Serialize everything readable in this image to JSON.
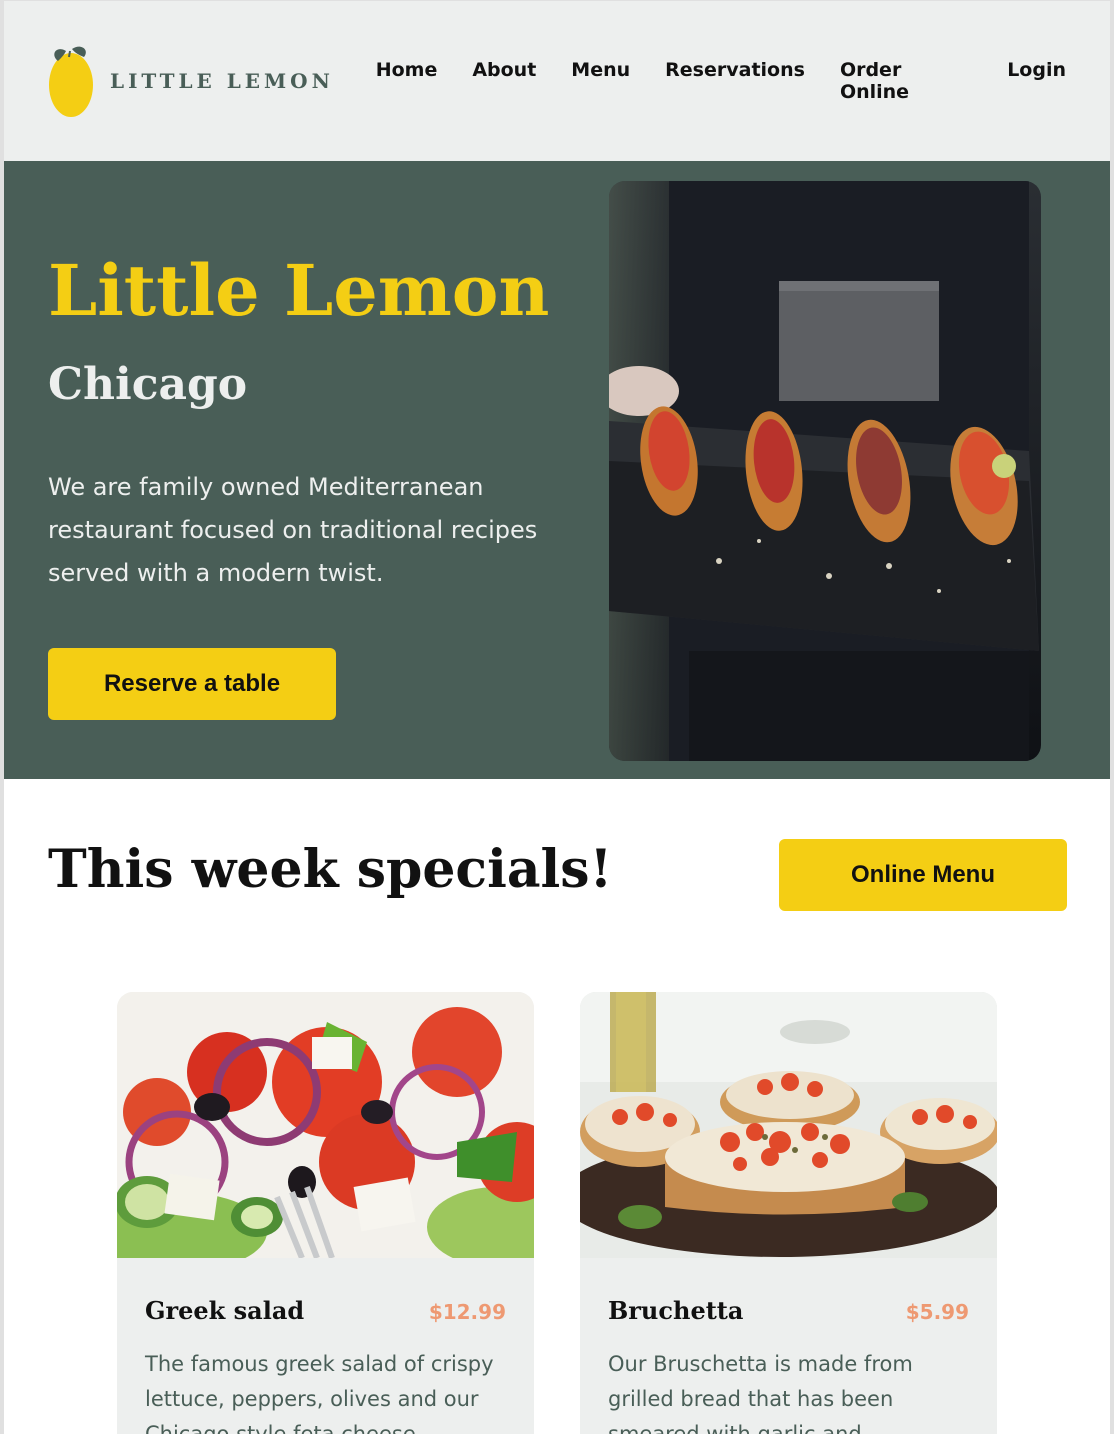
{
  "header": {
    "logo_text": "LITTLE LEMON",
    "nav": [
      "Home",
      "About",
      "Menu",
      "Reservations",
      "Order Online",
      "Login"
    ]
  },
  "hero": {
    "title": "Little Lemon",
    "subtitle": "Chicago",
    "description": "We are family owned Mediterranean restaurant focused on traditional recipes served with a modern twist.",
    "button": "Reserve a table"
  },
  "specials": {
    "title": "This week specials!",
    "button": "Online Menu",
    "items": [
      {
        "name": "Greek salad",
        "price": "$12.99",
        "description": "The famous greek salad of crispy lettuce, peppers, olives and our Chicago style feta cheese"
      },
      {
        "name": "Bruchetta",
        "price": "$5.99",
        "description": "Our Bruschetta is made from grilled bread that has been smeared with garlic and"
      }
    ]
  },
  "colors": {
    "primary_green": "#495e57",
    "primary_yellow": "#f4ce14",
    "highlight_light": "#edefee",
    "price_orange": "#ee9972"
  }
}
